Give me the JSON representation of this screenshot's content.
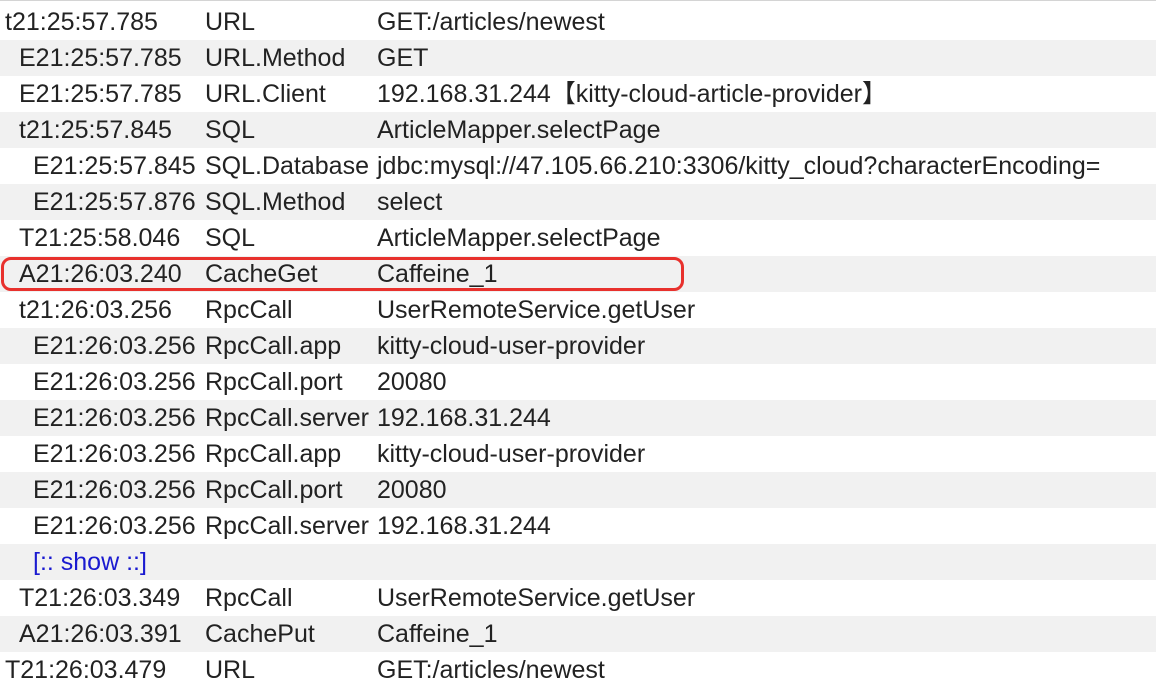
{
  "rows": [
    {
      "time": "t21:25:57.785",
      "type": "URL",
      "name": "GET:/articles/newest"
    },
    {
      "time": "E21:25:57.785",
      "type": "URL.Method",
      "name": "GET"
    },
    {
      "time": "E21:25:57.785",
      "type": "URL.Client",
      "name": "192.168.31.244【kitty-cloud-article-provider】"
    },
    {
      "time": "t21:25:57.845",
      "type": "SQL",
      "name": "ArticleMapper.selectPage"
    },
    {
      "time": "E21:25:57.845",
      "type": "SQL.Database",
      "name": "jdbc:mysql://47.105.66.210:3306/kitty_cloud?characterEncoding="
    },
    {
      "time": "E21:25:57.876",
      "type": "SQL.Method",
      "name": "select"
    },
    {
      "time": "T21:25:58.046",
      "type": "SQL",
      "name": "ArticleMapper.selectPage"
    },
    {
      "time": "A21:26:03.240",
      "type": "CacheGet",
      "name": "Caffeine_1"
    },
    {
      "time": "t21:26:03.256",
      "type": "RpcCall",
      "name": "UserRemoteService.getUser"
    },
    {
      "time": "E21:26:03.256",
      "type": "RpcCall.app",
      "name": "kitty-cloud-user-provider"
    },
    {
      "time": "E21:26:03.256",
      "type": "RpcCall.port",
      "name": "20080"
    },
    {
      "time": "E21:26:03.256",
      "type": "RpcCall.server",
      "name": "192.168.31.244"
    },
    {
      "time": "E21:26:03.256",
      "type": "RpcCall.app",
      "name": "kitty-cloud-user-provider"
    },
    {
      "time": "E21:26:03.256",
      "type": "RpcCall.port",
      "name": "20080"
    },
    {
      "time": "E21:26:03.256",
      "type": "RpcCall.server",
      "name": "192.168.31.244"
    },
    {
      "show_label": "[:: show ::]"
    },
    {
      "time": "T21:26:03.349",
      "type": "RpcCall",
      "name": "UserRemoteService.getUser"
    },
    {
      "time": "A21:26:03.391",
      "type": "CachePut",
      "name": "Caffeine_1"
    },
    {
      "time": "T21:26:03.479",
      "type": "URL",
      "name": "GET:/articles/newest"
    }
  ],
  "colors": {
    "text": "#222222",
    "stripe": "#f1f1f1",
    "link": "#1a1ad0",
    "highlight_border": "#e8312d"
  }
}
